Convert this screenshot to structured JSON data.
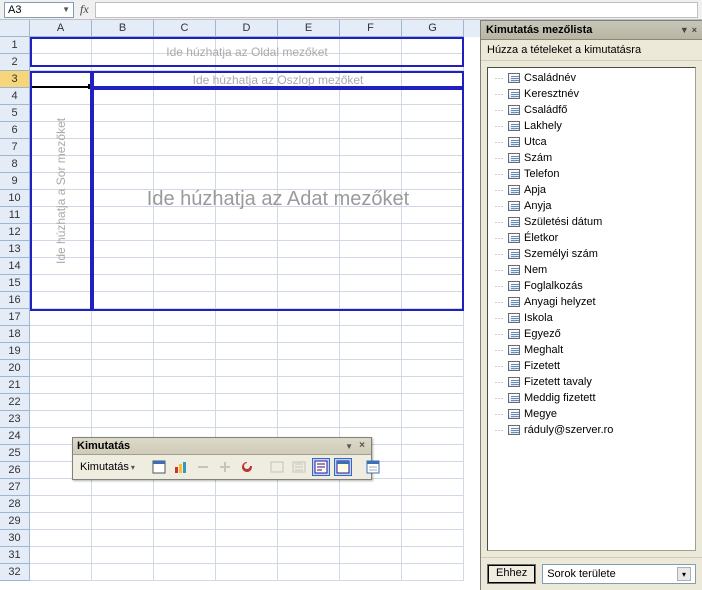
{
  "formula": {
    "namebox": "A3",
    "fx_label": "fx"
  },
  "columns": [
    "A",
    "B",
    "C",
    "D",
    "E",
    "F",
    "G"
  ],
  "row_count": 32,
  "selected_row_header": 3,
  "drop_zones": {
    "page": "Ide húzhatja az Oldal mezőket",
    "col": "Ide húzhatja az Oszlop mezőket",
    "row": "Ide húzhatja a Sor mezőket",
    "data": "Ide húzhatja az Adat mezőket"
  },
  "toolbar": {
    "title": "Kimutatás",
    "menu_label": "Kimutatás"
  },
  "fieldlist": {
    "title": "Kimutatás mezőlista",
    "subtitle": "Húzza a tételeket a kimutatásra",
    "button": "Ehhez",
    "dropdown": "Sorok területe",
    "items": [
      "Családnév",
      "Keresztnév",
      "Családfő",
      "Lakhely",
      "Utca",
      "Szám",
      "Telefon",
      "Apja",
      "Anyja",
      "Születési dátum",
      "Életkor",
      "Személyi szám",
      "Nem",
      "Foglalkozás",
      "Anyagi helyzet",
      "Iskola",
      "Egyező",
      "Meghalt",
      "Fizetett",
      "Fizetett tavaly",
      "Meddig fizetett",
      "Megye",
      "ráduly@szerver.ro"
    ]
  }
}
